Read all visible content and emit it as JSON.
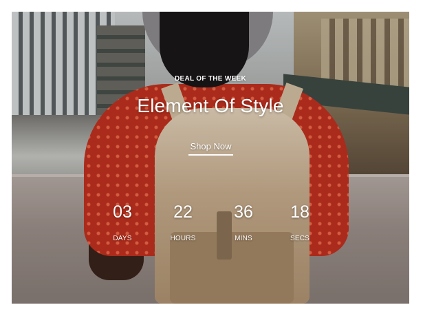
{
  "banner": {
    "eyebrow": "DEAL OF THE WEEK",
    "title": "Element Of Style",
    "cta_label": "Shop Now",
    "text_color": "#ffffff"
  },
  "countdown": [
    {
      "value": "03",
      "label": "DAYS"
    },
    {
      "value": "22",
      "label": "HOURS"
    },
    {
      "value": "36",
      "label": "MINS"
    },
    {
      "value": "18",
      "label": "SECS"
    }
  ]
}
